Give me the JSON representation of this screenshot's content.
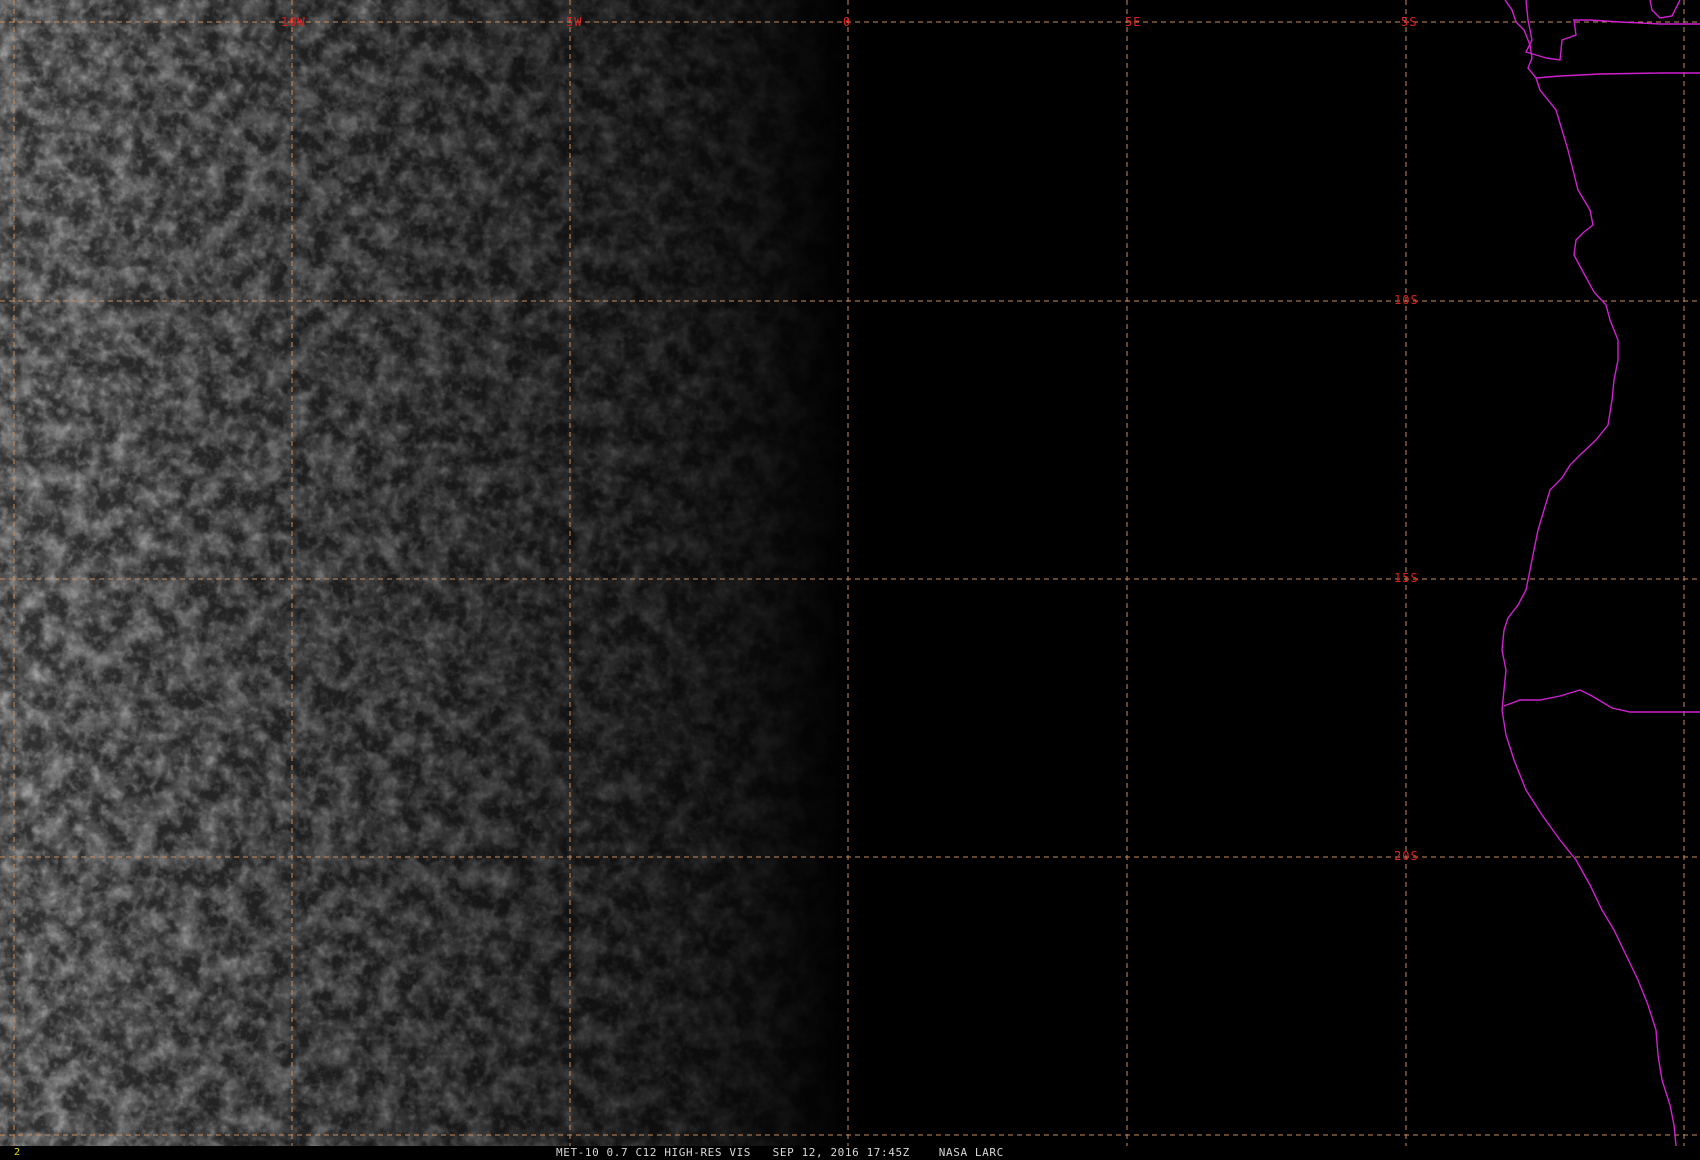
{
  "image": {
    "sensor": "MET-10",
    "channel": "0.7",
    "caption": "MET-10 0.7 C12 HIGH-RES VIS   SEP 12, 2016 17:45Z    NASA LARC",
    "frame_number": "2"
  },
  "grid": {
    "longitude_labels": [
      "10W",
      "5W",
      "0",
      "5E"
    ],
    "latitude_labels": [
      "5S",
      "10S",
      "15S",
      "20S"
    ]
  },
  "colors": {
    "background": "#000000",
    "grid_line": "#c88a5a",
    "grid_label": "#e02020",
    "coastline": "#d020d0",
    "caption_text": "#d8d8d8",
    "frame_number": "#e0e000"
  }
}
